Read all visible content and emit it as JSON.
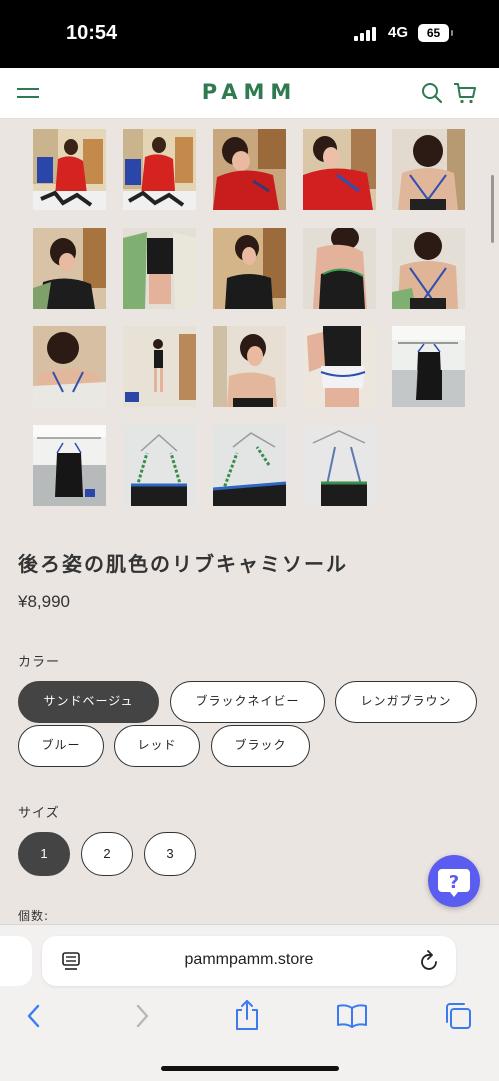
{
  "status_bar": {
    "time": "10:54",
    "network": "4G",
    "battery": "65"
  },
  "header": {
    "logo": "PAMM",
    "icons": [
      "menu-icon",
      "search-icon",
      "cart-icon"
    ]
  },
  "gallery": {
    "thumbnail_count": 19
  },
  "product": {
    "title": "後ろ姿の肌色のリブキャミソール",
    "price": "¥8,990",
    "color_label": "カラー",
    "colors": [
      "サンドベージュ",
      "ブラックネイビー",
      "レンガブラウン",
      "ブルー",
      "レッド",
      "ブラック"
    ],
    "selected_color": "サンドベージュ",
    "size_label": "サイズ",
    "sizes": [
      "1",
      "2",
      "3"
    ],
    "selected_size": "1",
    "quantity_label": "個数:"
  },
  "browser": {
    "url": "pammpamm.store"
  },
  "colors": {
    "brand_green": "#2f7a50",
    "help_purple": "#5b5cf0",
    "ios_blue": "#3a7bf2",
    "background": "#ebe5e2"
  }
}
